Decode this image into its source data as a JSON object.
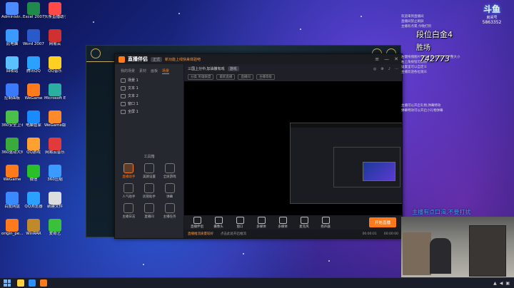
{
  "desktop": {
    "icons": [
      {
        "label": "Administr...",
        "color": "#4a8cff"
      },
      {
        "label": "Excel 2007",
        "color": "#1f8a4a"
      },
      {
        "label": "头条直播助手",
        "color": "#ff4a4a"
      },
      {
        "label": "此电脑",
        "color": "#3a9aff"
      },
      {
        "label": "Word 2007",
        "color": "#2a5aca"
      },
      {
        "label": "网易云",
        "color": "#d03030"
      },
      {
        "label": "回收站",
        "color": "#5ac0ff"
      },
      {
        "label": "腾讯QQ",
        "color": "#2aa0ff"
      },
      {
        "label": "QQ音乐",
        "color": "#ffd020"
      },
      {
        "label": "控制面板",
        "color": "#3a7aff"
      },
      {
        "label": "WeGame",
        "color": "#ff7a1a"
      },
      {
        "label": "Microsoft Edge",
        "color": "#2ab0a0"
      },
      {
        "label": "360安全卫士",
        "color": "#4ac04a"
      },
      {
        "label": "电脑管家",
        "color": "#1a8aff"
      },
      {
        "label": "WeGame版",
        "color": "#ff8a2a"
      },
      {
        "label": "360驱动大师",
        "color": "#3aaa3a"
      },
      {
        "label": "QQ游戏",
        "color": "#ffa030"
      },
      {
        "label": "网易云音乐",
        "color": "#e03a3a"
      },
      {
        "label": "WeGame",
        "color": "#ff7a1a"
      },
      {
        "label": "微信",
        "color": "#2ac02a"
      },
      {
        "label": "360压缩",
        "color": "#3a9aff"
      },
      {
        "label": "百度网盘",
        "color": "#3a8aff"
      },
      {
        "label": "QQ浏览器",
        "color": "#2aa0ff"
      },
      {
        "label": "新建文件",
        "color": "#dddddd"
      },
      {
        "label": "origin_pe...",
        "color": "#ff7a1a"
      },
      {
        "label": "WinRAR",
        "color": "#c08a2a"
      },
      {
        "label": "爱奇艺",
        "color": "#3ac03a"
      }
    ]
  },
  "app": {
    "name": "直播伴侣",
    "version": "正式",
    "notice": "新功能上线快来体验吧",
    "left_tabs": [
      "我的场景",
      "素材",
      "画板",
      "场景"
    ],
    "active_tab": "场景",
    "scenes": [
      "场景 1",
      "文本 1",
      "文本 2",
      "窗口 1",
      "全屏 1"
    ],
    "tools_header": "工具箱",
    "tools": [
      {
        "label": "直播助手",
        "hot": true
      },
      {
        "label": "美颜设置",
        "hot": false
      },
      {
        "label": "全屏游戏",
        "hot": false
      },
      {
        "label": "人气助手",
        "hot": false
      },
      {
        "label": "房管助手",
        "hot": false
      },
      {
        "label": "弹幕",
        "hot": false
      },
      {
        "label": "主播日志",
        "hot": false
      },
      {
        "label": "直播间",
        "hot": false
      },
      {
        "label": "主播任务",
        "hot": false
      }
    ],
    "main_title": "三国上分中,加油撒有戏",
    "main_tag": "游戏",
    "main_sub": [
      "分类 英雄联盟",
      "最新直播",
      "直播间",
      "主播等级"
    ],
    "bottom_buttons": [
      "直播伴侣",
      "摄像头",
      "窗口",
      "多媒体",
      "多媒体",
      "麦克风",
      "扬声器"
    ],
    "start_label": "开始直播",
    "status_warn": "直播推流质量较好",
    "status_text": "点击此处开启推流",
    "status_time1": "00:00:01",
    "status_time2": "00:00:00"
  },
  "overlay": {
    "brand": "斗鱼",
    "room_label": "房间号",
    "room_id": "5863352",
    "rank": "段位白金4",
    "wins_label": "胜场",
    "number": "742773",
    "marquee": "主播有点口渴,不要打扰",
    "chat_lines": [
      "欢迎来到直播间",
      "直播间禁止刷屏",
      "主播有点累,今晚打到",
      "左键拖拽图片移动位置,左键拉伸调整大小",
      "右上角按钮可删除",
      "设置里可以自定义",
      "主播欢迎各位观众",
      "主播可以开启礼物,弹幕特效",
      "弹幕特效可以开启小礼物弹幕"
    ]
  }
}
